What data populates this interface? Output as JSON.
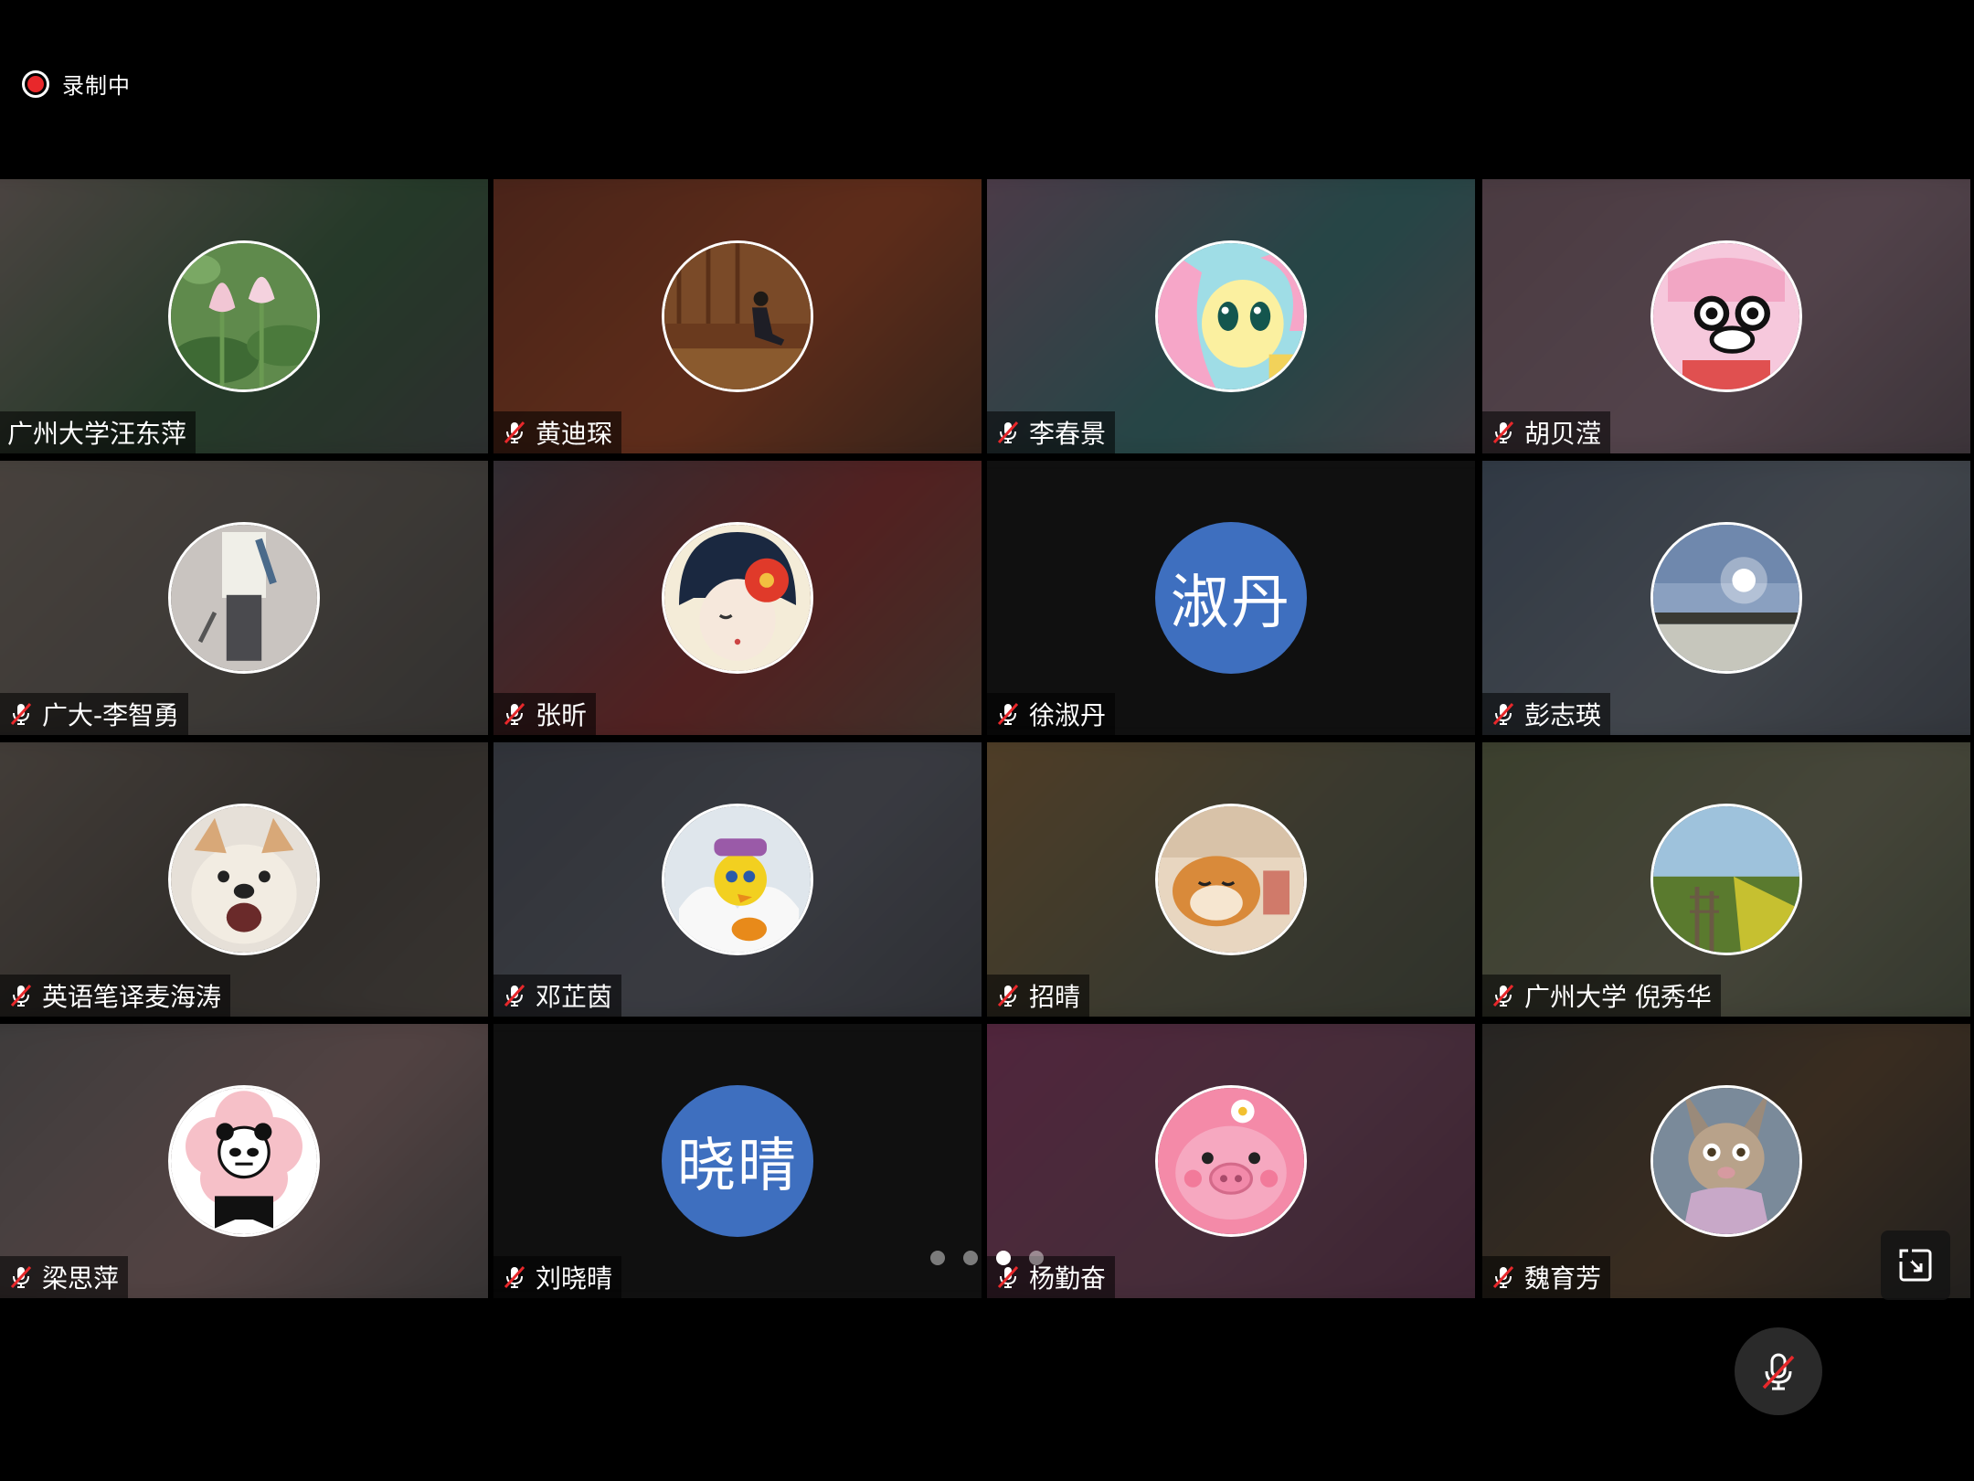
{
  "status": {
    "recording_label": "录制中",
    "recording_color": "#e8282b"
  },
  "participants": [
    {
      "name": "广州大学汪东萍",
      "muted": false,
      "avatar": "lotus-photo-icon",
      "bg": [
        "#6a5a5a",
        "#2f4a34",
        "#3c3a3e"
      ]
    },
    {
      "name": "黄迪琛",
      "muted": true,
      "avatar": "sitting-person-photo-icon",
      "bg": [
        "#5a2c20",
        "#7a3a22",
        "#3a2a22"
      ]
    },
    {
      "name": "李春景",
      "muted": true,
      "avatar": "pink-pony-cartoon-icon",
      "bg": [
        "#6a4a5e",
        "#2f5a5a",
        "#5e4e58"
      ]
    },
    {
      "name": "胡贝滢",
      "muted": true,
      "avatar": "crayon-shin-chan-pig-icon",
      "bg": [
        "#5e4a52",
        "#6a5660",
        "#463e44"
      ]
    },
    {
      "name": "广大-李智勇",
      "muted": true,
      "avatar": "standing-person-photo-icon",
      "bg": [
        "#5e5650",
        "#4e4a46",
        "#3e3c3a"
      ]
    },
    {
      "name": "张昕",
      "muted": true,
      "avatar": "girl-with-flower-drawing-icon",
      "bg": [
        "#3a3e46",
        "#6a2a2a",
        "#4a4438"
      ]
    },
    {
      "name": "徐淑丹",
      "muted": true,
      "avatar_text": "淑丹",
      "bg": [
        "#151515",
        "#151515",
        "#151515"
      ]
    },
    {
      "name": "彭志瑛",
      "muted": true,
      "avatar": "winter-sun-landscape-icon",
      "bg": [
        "#3a4656",
        "#545a62",
        "#3c4048"
      ]
    },
    {
      "name": "英语笔译麦海涛",
      "muted": true,
      "avatar": "shiba-dog-photo-icon",
      "bg": [
        "#5a524c",
        "#3e3a36",
        "#4a4440"
      ]
    },
    {
      "name": "邓芷茵",
      "muted": true,
      "avatar": "tweety-bird-cartoon-icon",
      "bg": [
        "#3c4048",
        "#4a4c54",
        "#36383e"
      ]
    },
    {
      "name": "招晴",
      "muted": true,
      "avatar": "sleeping-shiba-photo-icon",
      "bg": [
        "#6a5030",
        "#4a4a3c",
        "#3a3e36"
      ]
    },
    {
      "name": "广州大学 倪秀华",
      "muted": true,
      "avatar": "field-path-photo-icon",
      "bg": [
        "#4a5038",
        "#5a5a4a",
        "#3e4438"
      ]
    },
    {
      "name": "梁思萍",
      "muted": true,
      "avatar": "panda-meme-flower-icon",
      "bg": [
        "#4c4c4c",
        "#6a5656",
        "#3e3e3e"
      ]
    },
    {
      "name": "刘晓晴",
      "muted": true,
      "avatar_text": "晓晴",
      "bg": [
        "#151515",
        "#151515",
        "#151515"
      ]
    },
    {
      "name": "杨勤奋",
      "muted": true,
      "avatar": "pink-pig-cartoon-icon",
      "bg": [
        "#6a2e4e",
        "#5a3a4a",
        "#4a2a3e"
      ]
    },
    {
      "name": "魏育芳",
      "muted": true,
      "avatar": "cartoon-rabbit-icon",
      "bg": [
        "#2e2e2e",
        "#4a3a2a",
        "#262626"
      ]
    }
  ],
  "pager": {
    "count": 4,
    "active": 2
  },
  "controls": {
    "fullscreen": "fullscreen-exit-icon",
    "mic": "microphone-muted-icon"
  },
  "colors": {
    "avatar_text_bg": "#3e6fbf",
    "mute_icon_red": "#e8282b"
  }
}
